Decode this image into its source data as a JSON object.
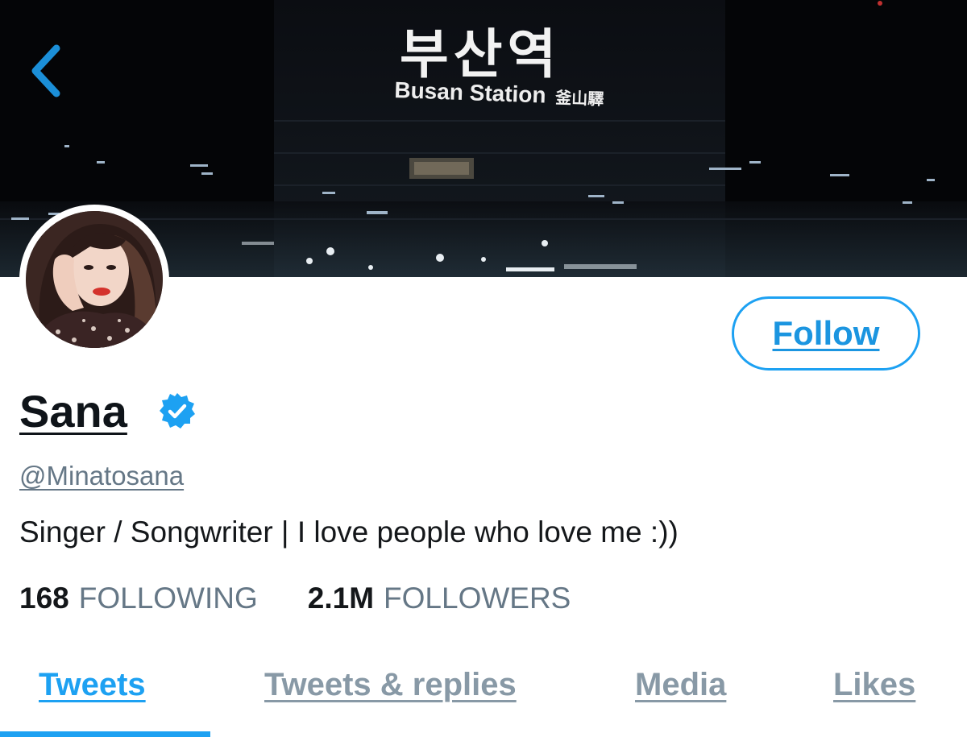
{
  "header": {
    "banner_sign_korean": "부산역",
    "banner_sign_english": "Busan Station",
    "banner_sign_hanja": "釜山驛",
    "back_icon": "chevron-left-icon"
  },
  "profile": {
    "display_name": "Sana",
    "verified_icon": "verified-badge-icon",
    "handle": "@Minatosana",
    "bio": "Singer / Songwriter | I love people who love me :))",
    "follow_label": "Follow"
  },
  "stats": {
    "following_count": "168",
    "following_label": "FOLLOWING",
    "followers_count": "2.1M",
    "followers_label": "FOLLOWERS"
  },
  "tabs": [
    {
      "label": "Tweets",
      "active": true
    },
    {
      "label": "Tweets & replies",
      "active": false
    },
    {
      "label": "Media",
      "active": false
    },
    {
      "label": "Likes",
      "active": false
    }
  ],
  "colors": {
    "accent": "#1da1f2",
    "secondary_text": "#657786",
    "tab_inactive": "#8899a6"
  }
}
